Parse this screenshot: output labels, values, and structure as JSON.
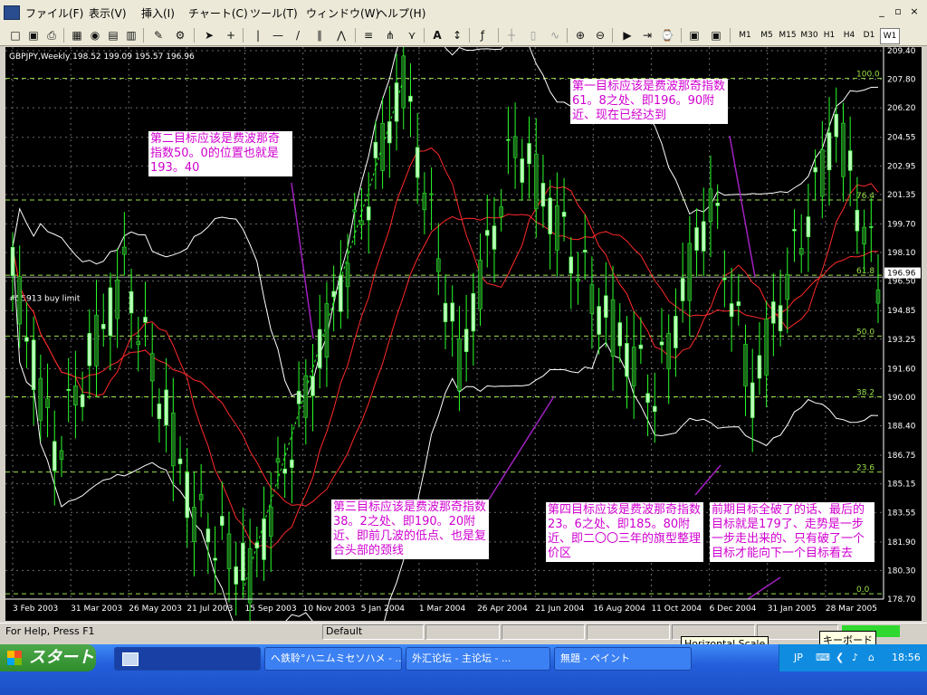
{
  "menubar": {
    "items": [
      "ファイル(F)",
      "表示(V)",
      "挿入(I)",
      "チャート(C)",
      "ツール(T)",
      "ウィンドウ(W)",
      "ヘルプ(H)"
    ],
    "win_min": "_",
    "win_restore": "▫",
    "win_close": "×"
  },
  "toolbar": {
    "timeframes": [
      "M1",
      "M5",
      "M15",
      "M30",
      "H1",
      "H4",
      "D1",
      "W1"
    ],
    "active_timeframe": "W1",
    "text_tool": "A"
  },
  "chart": {
    "header": "GBPJPY,Weekly  198.52 199.09 195.57 196.96",
    "price_ticks": [
      "209.40",
      "207.80",
      "206.20",
      "204.55",
      "202.95",
      "201.35",
      "199.70",
      "198.10",
      "196.50",
      "194.85",
      "193.25",
      "191.60",
      "190.00",
      "188.40",
      "186.75",
      "185.15",
      "183.55",
      "181.90",
      "180.30",
      "178.70"
    ],
    "current_price": "196.96",
    "date_ticks": [
      "3 Feb 2003",
      "31 Mar 2003",
      "26 May 2003",
      "21 Jul 2003",
      "15 Sep 2003",
      "10 Nov 2003",
      "5 Jan 2004",
      "1 Mar 2004",
      "26 Apr 2004",
      "21 Jun 2004",
      "16 Aug 2004",
      "11 Oct 2004",
      "6 Dec 2004",
      "31 Jan 2005",
      "28 Mar 2005"
    ],
    "fib_levels": [
      "100.0",
      "76.4",
      "61.8",
      "50.0",
      "38.2",
      "23.6",
      "0.0"
    ],
    "order_label": "#55913 buy limit",
    "notes": {
      "n1": "第一目标应该是费波那奇指数61。8之处、即196。90附近、现在已经达到",
      "n2": "第二目标应该是费波那奇指数50。0的位置也就是193。40",
      "n3": "第三目标应该是费波那奇指数38。2之处、即190。20附近、即前几波的低点、也是复合头部的颈线",
      "n4": "第四目标应该是费波那奇指数23。6之处、即185。80附近、即二〇〇三年的旗型整理价区",
      "n5": "前期目标全破了的话、最后的目标就是179了、走势是一步一步走出来的、只有破了一个目标才能向下一个目标看去"
    }
  },
  "statusbar": {
    "help": "For Help, Press F1",
    "profile": "Default"
  },
  "tooltips": {
    "horizontal_scale": "Horizontal Scale",
    "keyboard": "キーボード"
  },
  "taskbar": {
    "start": "スタート",
    "tasks": [
      "へ鉄聆°ハニムミセソハメ - ...",
      "外汇论坛 - 主论坛 - ...",
      "無題 - ペイント"
    ],
    "lang": "JP",
    "time": "18:56"
  },
  "colors": {
    "bull": "#b8ffb8",
    "bear": "#1a6b1a",
    "wick": "#2aff2a",
    "bands": "#ffffff",
    "ma": "#ff2a2a",
    "fib": "#9be04a",
    "note_text": "#d000d0",
    "current_price_box": "#ffffff"
  }
}
